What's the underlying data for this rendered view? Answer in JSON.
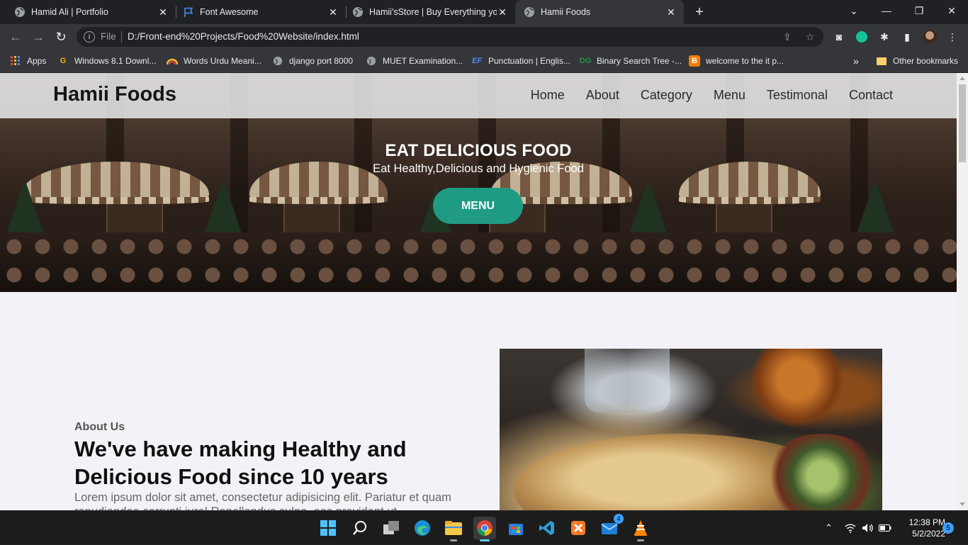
{
  "browser": {
    "tabs": [
      {
        "title": "Hamid Ali | Portfolio",
        "icon": "globe-icon"
      },
      {
        "title": "Font Awesome",
        "icon": "flag-icon"
      },
      {
        "title": "Hamii'sStore | Buy Everything you",
        "icon": "globe-icon"
      },
      {
        "title": "Hamii Foods",
        "icon": "globe-icon",
        "active": true
      }
    ],
    "address": {
      "scheme_label": "File",
      "url": "D:/Front-end%20Projects/Food%20Website/index.html"
    },
    "bookmarks": [
      {
        "label": "Apps",
        "icon": "apps-grid-icon"
      },
      {
        "label": "Windows 8.1 Downl...",
        "icon": "g-logo-icon"
      },
      {
        "label": "Words Urdu Meani...",
        "icon": "rainbow-icon"
      },
      {
        "label": "django port 8000",
        "icon": "globe-icon"
      },
      {
        "label": "MUET Examination...",
        "icon": "globe-icon"
      },
      {
        "label": "Punctuation | Englis...",
        "icon": "ef-logo-icon"
      },
      {
        "label": "Binary Search Tree -...",
        "icon": "dg-logo-icon"
      },
      {
        "label": "welcome to the it p...",
        "icon": "blogger-icon"
      }
    ],
    "bookmarks_overflow": "»",
    "other_bookmarks": "Other bookmarks"
  },
  "site": {
    "brand": "Hamii Foods",
    "nav": [
      "Home",
      "About",
      "Category",
      "Menu",
      "Testimonal",
      "Contact"
    ],
    "hero": {
      "title": "EAT DELICIOUS FOOD",
      "subtitle": "Eat Healthy,Delicious and Hygienic Food",
      "button": "MENU"
    },
    "about": {
      "kicker": "About Us",
      "title": "We've have making Healthy and Delicious Food since 10 years",
      "text": "Lorem ipsum dolor sit amet, consectetur adipisicing elit. Pariatur et quam repudiandae corrupti iure! Repellendus culpa, eos provident ut"
    }
  },
  "taskbar": {
    "apps": [
      "windows-start-icon",
      "search-icon",
      "task-view-icon",
      "edge-icon",
      "file-explorer-icon",
      "chrome-icon",
      "microsoft-store-icon",
      "vscode-icon",
      "xampp-icon",
      "mail-icon",
      "vlc-icon"
    ],
    "mail_badge": "4",
    "time": "12:38 PM",
    "date": "5/2/2022",
    "notifications": "5"
  },
  "colors": {
    "accent": "#1f9b84",
    "chrome_dark": "#202124",
    "chrome_toolbar": "#35363a"
  }
}
